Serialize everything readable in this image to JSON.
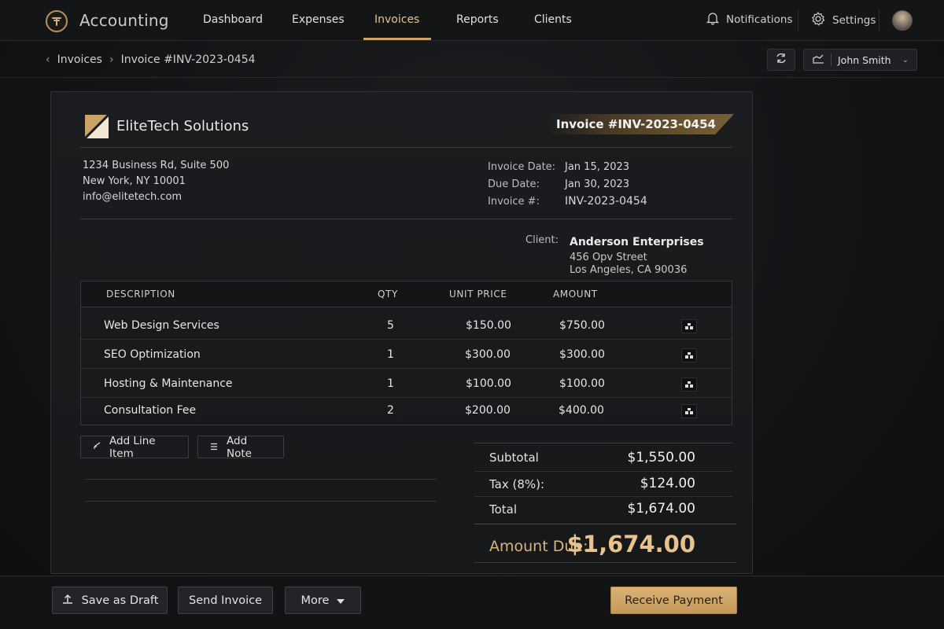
{
  "app": {
    "title": "Accounting"
  },
  "nav": {
    "items": [
      "Dashboard",
      "Expenses",
      "Invoices",
      "Reports",
      "Clients"
    ],
    "active": "Invoices"
  },
  "top_actions": {
    "notifications": "Notifications",
    "settings": "Settings"
  },
  "breadcrumb": {
    "parent": "Invoices",
    "current": "Invoice #INV-2023-0454"
  },
  "user": {
    "name": "John Smith"
  },
  "invoice": {
    "company_name": "EliteTech Solutions",
    "banner_title": "Invoice #INV-2023-0454",
    "company_address": [
      "1234 Business Rd, Suite 500",
      "New York, NY 10001",
      "info@elitetech.com"
    ],
    "meta": [
      {
        "label": "Invoice Date:",
        "value": "Jan 15, 2023"
      },
      {
        "label": "Due Date:",
        "value": "Jan 30, 2023"
      },
      {
        "label": "Invoice #:",
        "value": "INV-2023-0454"
      }
    ],
    "client": {
      "label": "Client:",
      "name": "Anderson Enterprises",
      "address": [
        "456 Opv Street",
        "Los Angeles, CA 90036"
      ]
    },
    "table": {
      "headers": {
        "description": "DESCRIPTION",
        "qty": "QTY",
        "unit_price": "UNIT PRICE",
        "amount": "AMOUNT"
      },
      "rows": [
        {
          "description": "Web Design Services",
          "qty": "5",
          "unit_price": "$150.00",
          "amount": "$750.00"
        },
        {
          "description": "SEO Optimization",
          "qty": "1",
          "unit_price": "$300.00",
          "amount": "$300.00"
        },
        {
          "description": "Hosting & Maintenance",
          "qty": "1",
          "unit_price": "$100.00",
          "amount": "$100.00"
        },
        {
          "description": "Consultation Fee",
          "qty": "2",
          "unit_price": "$200.00",
          "amount": "$400.00"
        }
      ]
    },
    "actions": {
      "add_line_item": "Add Line Item",
      "add_note": "Add Note"
    },
    "totals": {
      "subtotal_label": "Subtotal",
      "subtotal": "$1,550.00",
      "tax_label": "Tax (8%):",
      "tax": "$124.00",
      "total_label": "Total",
      "total": "$1,674.00",
      "amount_due_label": "Amount Due:",
      "amount_due": "$1,674.00"
    }
  },
  "footer": {
    "save_draft": "Save as Draft",
    "send_invoice": "Send Invoice",
    "more": "More",
    "receive_payment": "Receive Payment"
  },
  "colors": {
    "accent": "#c9a468",
    "background": "#141517",
    "card": "#1b1c1f"
  }
}
